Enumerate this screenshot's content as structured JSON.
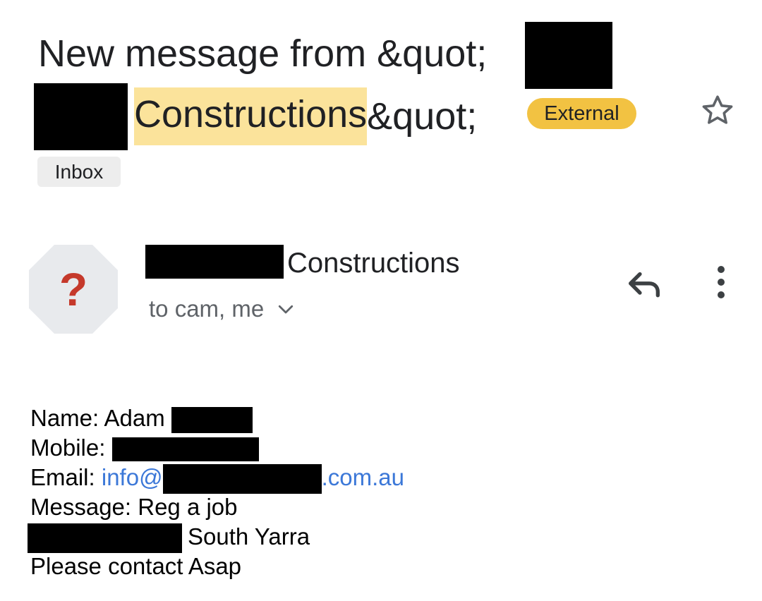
{
  "subject": {
    "prefix": "New message from &quot;",
    "highlight": "Constructions",
    "suffix": "&quot;"
  },
  "badges": {
    "external": "External",
    "label": "Inbox"
  },
  "sender": {
    "avatar_glyph": "?",
    "name": "Constructions",
    "recipients": "to cam, me"
  },
  "icons": {
    "star": "star-outline-icon",
    "reply": "reply-icon",
    "more": "more-vertical-icon",
    "expand": "chevron-down-icon"
  },
  "body": {
    "name_label": "Name: Adam ",
    "mobile_label": "Mobile: ",
    "email_label": "Email: ",
    "email_prefix": "info@",
    "email_suffix": ".com.au",
    "message_label": "Message: Reg a job",
    "suburb": "South Yarra",
    "closing": "Please contact Asap"
  },
  "colors": {
    "highlight": "#fbe39b",
    "external_badge": "#f2c242",
    "link": "#3c78d8",
    "avatar_bg": "#e8eaed",
    "avatar_glyph": "#c5392b"
  }
}
